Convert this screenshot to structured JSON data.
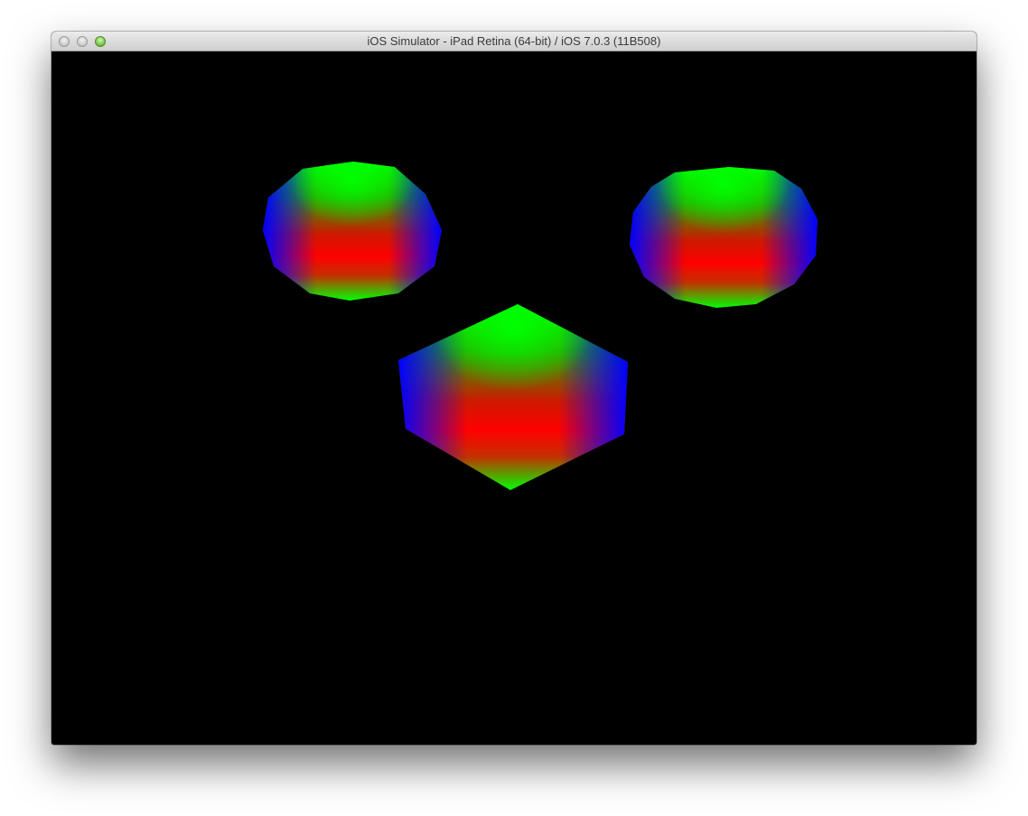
{
  "window": {
    "title": "iOS Simulator - iPad Retina (64-bit) / iOS 7.0.3 (11B508)",
    "controls": [
      "close-button",
      "minimize-button",
      "zoom-button"
    ]
  },
  "scene": {
    "background_color": "#000000",
    "objects": [
      {
        "name": "left-sphere",
        "shape": "sphere",
        "top_color": "#00ff00",
        "side_color": "#0000ff",
        "middle_color": "#ff0000"
      },
      {
        "name": "right-sphere",
        "shape": "sphere",
        "top_color": "#00ff00",
        "side_color": "#0000ff",
        "middle_color": "#ff0000"
      },
      {
        "name": "center-octahedron",
        "shape": "octahedron",
        "top_color": "#00ff00",
        "side_color": "#0000ff",
        "middle_color": "#ff0000"
      }
    ]
  }
}
